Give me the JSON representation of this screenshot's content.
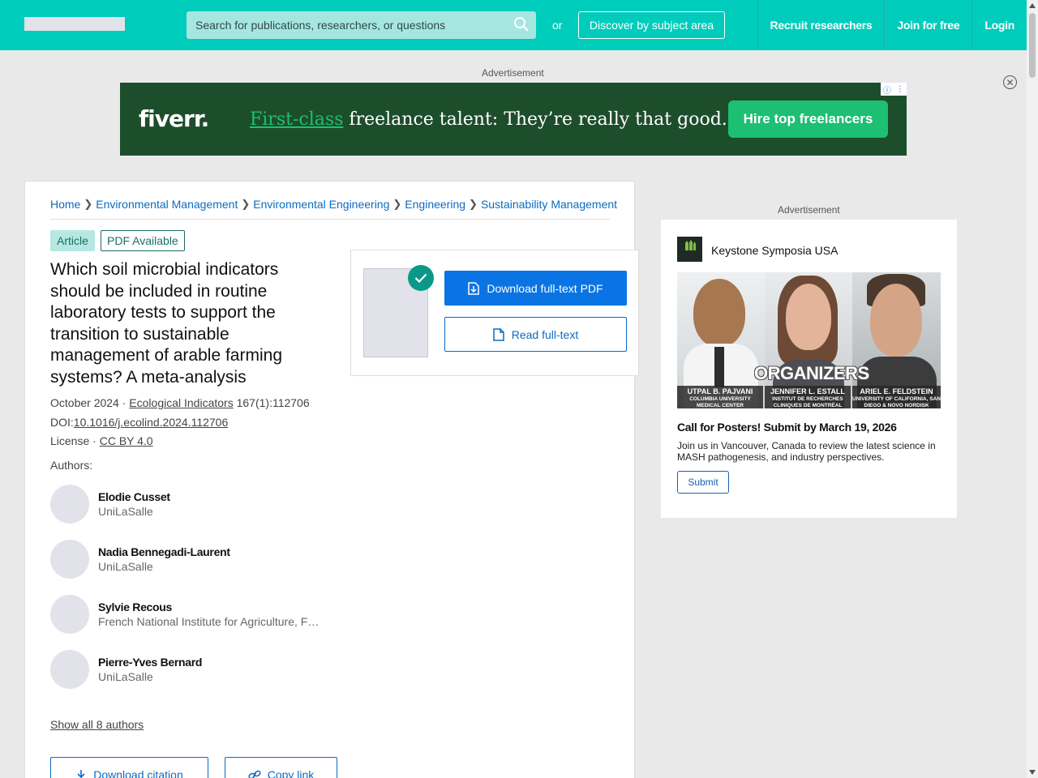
{
  "header": {
    "search_placeholder": "Search for publications, researchers, or questions",
    "or_text": "or",
    "discover_label": "Discover by subject area",
    "nav": [
      "Recruit researchers",
      "Join for free",
      "Login"
    ]
  },
  "top_ad": {
    "label": "Advertisement",
    "brand": "fiverr.",
    "tagline_highlight": "First-class",
    "tagline_rest": " freelance talent: They’re really that good.",
    "cta": "Hire top freelancers",
    "colors": {
      "background": "#1d4e2c",
      "accent": "#1dbf73"
    }
  },
  "breadcrumb": [
    "Home",
    "Environmental Management",
    "Environmental Engineering",
    "Engineering",
    "Sustainability Management"
  ],
  "article": {
    "type_badge": "Article",
    "pdf_badge": "PDF Available",
    "title": "Which soil microbial indicators should be included in routine laboratory tests to support the transition to sustainable management of arable farming systems? A meta-analysis",
    "date": "October 2024",
    "journal": "Ecological Indicators",
    "volume": "167(1):112706",
    "doi_label": "DOI:",
    "doi": "10.1016/j.ecolind.2024.112706",
    "license_label": "License ·",
    "license": "CC BY 4.0",
    "authors_label": "Authors:",
    "authors": [
      {
        "name": "Elodie Cusset",
        "affiliation": "UniLaSalle"
      },
      {
        "name": "Nadia Bennegadi-Laurent",
        "affiliation": "UniLaSalle"
      },
      {
        "name": "Sylvie Recous",
        "affiliation": "French National Institute for Agriculture, Food, and Environment"
      },
      {
        "name": "Pierre-Yves Bernard",
        "affiliation": "UniLaSalle"
      }
    ],
    "show_all": "Show all 8 authors",
    "download_citation": "Download citation",
    "copy_link": "Copy link"
  },
  "pdf_box": {
    "download_label": "Download full-text PDF",
    "read_label": "Read full-text"
  },
  "side_ad": {
    "label": "Advertisement",
    "sponsor": "Keystone Symposia USA",
    "logo_text": "KEYSTONE SYMPOSIA",
    "banner_title": "ORGANIZERS",
    "people": [
      {
        "name": "UTPAL B. PAJVANI",
        "inst": "COLUMBIA UNIVERSITY MEDICAL CENTER"
      },
      {
        "name": "JENNIFER L. ESTALL",
        "inst": "INSTITUT DE RECHERCHES CLINIQUES DE MONTRÉAL"
      },
      {
        "name": "ARIEL E. FELDSTEIN",
        "inst": "UNIVERSITY OF CALIFORNIA, SAN DIEGO & NOVO NORDISK"
      }
    ],
    "headline": "Call for Posters! Submit by March 19, 2026",
    "body": "Join us in Vancouver, Canada to review the latest science in MASH pathogenesis, and industry perspectives.",
    "submit": "Submit"
  },
  "colors": {
    "brand": "#00ccbb",
    "link": "#0b6bc3",
    "primary_button": "#0b74e5"
  }
}
